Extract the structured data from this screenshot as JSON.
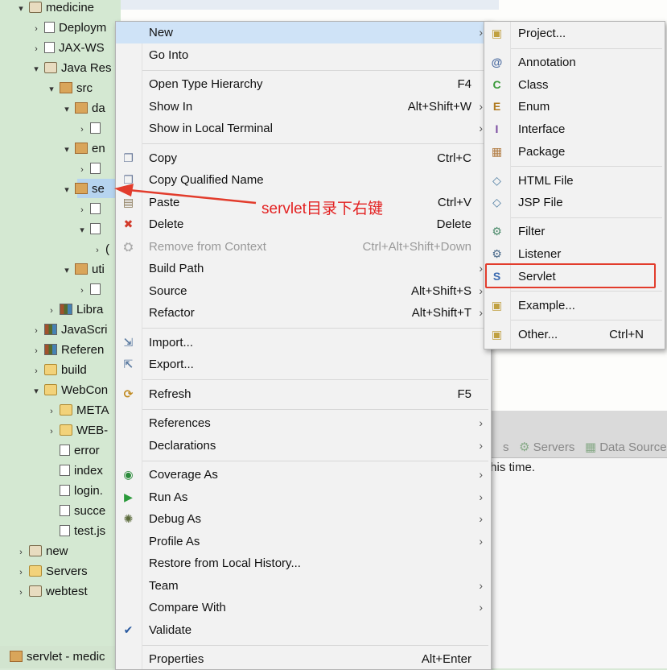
{
  "tree": {
    "rows": [
      {
        "label": "medicine",
        "indent": 0,
        "twisty": "open",
        "icon": "project"
      },
      {
        "label": "Deploym",
        "indent": 1,
        "twisty": "closed",
        "icon": "file"
      },
      {
        "label": "JAX-WS",
        "indent": 1,
        "twisty": "closed",
        "icon": "file"
      },
      {
        "label": "Java Res",
        "indent": 1,
        "twisty": "open",
        "icon": "project"
      },
      {
        "label": "src",
        "indent": 2,
        "twisty": "open",
        "icon": "pkg"
      },
      {
        "label": "da",
        "indent": 3,
        "twisty": "open",
        "icon": "pkg"
      },
      {
        "label": "",
        "indent": 4,
        "twisty": "closed",
        "icon": "file"
      },
      {
        "label": "en",
        "indent": 3,
        "twisty": "open",
        "icon": "pkg"
      },
      {
        "label": "",
        "indent": 4,
        "twisty": "closed",
        "icon": "file"
      },
      {
        "label": "se",
        "indent": 3,
        "twisty": "open",
        "icon": "pkg"
      },
      {
        "label": "",
        "indent": 4,
        "twisty": "closed",
        "icon": "file"
      },
      {
        "label": "",
        "indent": 4,
        "twisty": "open",
        "icon": "file"
      },
      {
        "label": "(",
        "indent": 5,
        "twisty": "closed",
        "icon": "none"
      },
      {
        "label": "uti",
        "indent": 3,
        "twisty": "open",
        "icon": "pkg"
      },
      {
        "label": "",
        "indent": 4,
        "twisty": "closed",
        "icon": "file"
      },
      {
        "label": "Libra",
        "indent": 2,
        "twisty": "closed",
        "icon": "lib"
      },
      {
        "label": "JavaScri",
        "indent": 1,
        "twisty": "closed",
        "icon": "lib"
      },
      {
        "label": "Referen",
        "indent": 1,
        "twisty": "closed",
        "icon": "lib"
      },
      {
        "label": "build",
        "indent": 1,
        "twisty": "closed",
        "icon": "folder"
      },
      {
        "label": "WebCon",
        "indent": 1,
        "twisty": "open",
        "icon": "folder"
      },
      {
        "label": "META",
        "indent": 2,
        "twisty": "closed",
        "icon": "folder"
      },
      {
        "label": "WEB-",
        "indent": 2,
        "twisty": "closed",
        "icon": "folder"
      },
      {
        "label": "error",
        "indent": 2,
        "twisty": "none",
        "icon": "file"
      },
      {
        "label": "index",
        "indent": 2,
        "twisty": "none",
        "icon": "file"
      },
      {
        "label": "login.",
        "indent": 2,
        "twisty": "none",
        "icon": "file"
      },
      {
        "label": "succe",
        "indent": 2,
        "twisty": "none",
        "icon": "file"
      },
      {
        "label": "test.js",
        "indent": 2,
        "twisty": "none",
        "icon": "file"
      },
      {
        "label": "new",
        "indent": 0,
        "twisty": "closed",
        "icon": "project"
      },
      {
        "label": "Servers",
        "indent": 0,
        "twisty": "closed",
        "icon": "folder"
      },
      {
        "label": "webtest",
        "indent": 0,
        "twisty": "closed",
        "icon": "project"
      }
    ]
  },
  "status_bar": {
    "text": "servlet - medic"
  },
  "bottom_panel": {
    "tabs": [
      "s",
      "Servers",
      "Data Source"
    ],
    "message": "this time."
  },
  "annotation": {
    "text": "servlet目录下右键",
    "color": "#e32222"
  },
  "context_menu": {
    "items": [
      {
        "label": "New",
        "shortcut": "",
        "submenu": true,
        "icon": "",
        "highlight": true
      },
      {
        "label": "Go Into",
        "shortcut": "",
        "submenu": false,
        "icon": ""
      },
      {
        "sep": true
      },
      {
        "label": "Open Type Hierarchy",
        "shortcut": "F4",
        "submenu": false,
        "icon": ""
      },
      {
        "label": "Show In",
        "shortcut": "Alt+Shift+W",
        "submenu": true,
        "icon": ""
      },
      {
        "label": "Show in Local Terminal",
        "shortcut": "",
        "submenu": true,
        "icon": ""
      },
      {
        "sep": true
      },
      {
        "label": "Copy",
        "shortcut": "Ctrl+C",
        "submenu": false,
        "icon": "copy-icon"
      },
      {
        "label": "Copy Qualified Name",
        "shortcut": "",
        "submenu": false,
        "icon": "copy-qualified-icon"
      },
      {
        "label": "Paste",
        "shortcut": "Ctrl+V",
        "submenu": false,
        "icon": "paste-icon"
      },
      {
        "label": "Delete",
        "shortcut": "Delete",
        "submenu": false,
        "icon": "delete-icon"
      },
      {
        "label": "Remove from Context",
        "shortcut": "Ctrl+Alt+Shift+Down",
        "submenu": false,
        "icon": "remove-context-icon",
        "disabled": true
      },
      {
        "label": "Build Path",
        "shortcut": "",
        "submenu": true,
        "icon": ""
      },
      {
        "label": "Source",
        "shortcut": "Alt+Shift+S",
        "submenu": true,
        "icon": ""
      },
      {
        "label": "Refactor",
        "shortcut": "Alt+Shift+T",
        "submenu": true,
        "icon": ""
      },
      {
        "sep": true
      },
      {
        "label": "Import...",
        "shortcut": "",
        "submenu": false,
        "icon": "import-icon"
      },
      {
        "label": "Export...",
        "shortcut": "",
        "submenu": false,
        "icon": "export-icon"
      },
      {
        "sep": true
      },
      {
        "label": "Refresh",
        "shortcut": "F5",
        "submenu": false,
        "icon": "refresh-icon"
      },
      {
        "sep": true
      },
      {
        "label": "References",
        "shortcut": "",
        "submenu": true,
        "icon": ""
      },
      {
        "label": "Declarations",
        "shortcut": "",
        "submenu": true,
        "icon": ""
      },
      {
        "sep": true
      },
      {
        "label": "Coverage As",
        "shortcut": "",
        "submenu": true,
        "icon": "coverage-icon"
      },
      {
        "label": "Run As",
        "shortcut": "",
        "submenu": true,
        "icon": "run-icon"
      },
      {
        "label": "Debug As",
        "shortcut": "",
        "submenu": true,
        "icon": "debug-icon"
      },
      {
        "label": "Profile As",
        "shortcut": "",
        "submenu": true,
        "icon": ""
      },
      {
        "label": "Restore from Local History...",
        "shortcut": "",
        "submenu": false,
        "icon": ""
      },
      {
        "label": "Team",
        "shortcut": "",
        "submenu": true,
        "icon": ""
      },
      {
        "label": "Compare With",
        "shortcut": "",
        "submenu": true,
        "icon": ""
      },
      {
        "label": "Validate",
        "shortcut": "",
        "submenu": false,
        "icon": "check-icon"
      },
      {
        "sep": true
      },
      {
        "label": "Properties",
        "shortcut": "Alt+Enter",
        "submenu": false,
        "icon": ""
      }
    ]
  },
  "new_submenu": {
    "items": [
      {
        "label": "Project...",
        "shortcut": "",
        "icon": "project-icon"
      },
      {
        "sep": true
      },
      {
        "label": "Annotation",
        "shortcut": "",
        "icon": "annotation-icon"
      },
      {
        "label": "Class",
        "shortcut": "",
        "icon": "class-icon"
      },
      {
        "label": "Enum",
        "shortcut": "",
        "icon": "enum-icon"
      },
      {
        "label": "Interface",
        "shortcut": "",
        "icon": "interface-icon"
      },
      {
        "label": "Package",
        "shortcut": "",
        "icon": "package-icon"
      },
      {
        "sep": true
      },
      {
        "label": "HTML File",
        "shortcut": "",
        "icon": "html-file-icon"
      },
      {
        "label": "JSP File",
        "shortcut": "",
        "icon": "jsp-file-icon"
      },
      {
        "sep": true
      },
      {
        "label": "Filter",
        "shortcut": "",
        "icon": "filter-icon"
      },
      {
        "label": "Listener",
        "shortcut": "",
        "icon": "listener-icon"
      },
      {
        "label": "Servlet",
        "shortcut": "",
        "icon": "servlet-icon",
        "boxed": true
      },
      {
        "sep": true
      },
      {
        "label": "Example...",
        "shortcut": "",
        "icon": "example-icon"
      },
      {
        "sep": true
      },
      {
        "label": "Other...",
        "shortcut": "Ctrl+N",
        "icon": "other-icon"
      }
    ]
  },
  "colors": {
    "accent": "#cfe3f7",
    "annotation_red": "#e23c2c"
  }
}
